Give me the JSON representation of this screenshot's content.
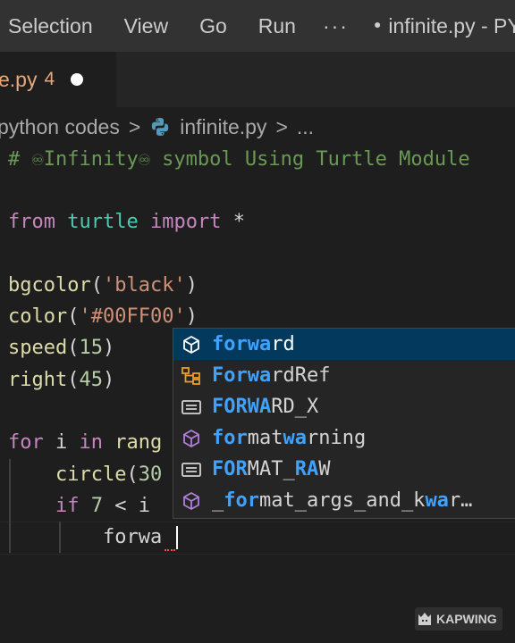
{
  "menubar": {
    "items": [
      {
        "label": "Selection"
      },
      {
        "label": "View"
      },
      {
        "label": "Go"
      },
      {
        "label": "Run"
      },
      {
        "label": "···"
      }
    ],
    "window_title": "infinite.py - PYT",
    "dirty_dot": "●"
  },
  "tab": {
    "name": "e.py",
    "problem_count": "4"
  },
  "breadcrumb": {
    "folder": "python codes",
    "sep1": ">",
    "file": "infinite.py",
    "sep2": ">",
    "more": "..."
  },
  "code": {
    "l1_comment": "# ♾Infinity♾ symbol Using Turtle Module",
    "l2_from": "from",
    "l2_mod": "turtle",
    "l2_import": "import",
    "l2_star": "*",
    "l3_fn": "bgcolor",
    "l3_open": "(",
    "l3_str": "'black'",
    "l3_close": ")",
    "l4_fn": "color",
    "l4_open": "(",
    "l4_str": "'#00FF00'",
    "l4_close": ")",
    "l5_fn": "speed",
    "l5_open": "(",
    "l5_num": "15",
    "l5_close": ")",
    "l6_fn": "right",
    "l6_open": "(",
    "l6_num": "45",
    "l6_close": ")",
    "l7_for": "for",
    "l7_var": "i",
    "l7_in": "in",
    "l7_fn": "rang",
    "l8_fn": "circle",
    "l8_open": "(",
    "l8_num": "30",
    "l9_if": "if",
    "l9_num": "7",
    "l9_lt": "<",
    "l9_var": "i",
    "l10_typed": "forwa"
  },
  "suggest": {
    "items": [
      {
        "icon": "method-cube-icon",
        "match": "forwa",
        "rest": "rd"
      },
      {
        "icon": "class-icon",
        "pre": "",
        "m1": "Forwa",
        "rest": "rdRef"
      },
      {
        "icon": "variable-icon",
        "m1": "FORWA",
        "rest": "RD_X"
      },
      {
        "icon": "method-cube-icon",
        "m1": "for",
        "mid": "mat",
        "m2": "wa",
        "rest": "rning"
      },
      {
        "icon": "variable-icon",
        "m1": "FOR",
        "mid": "MAT_",
        "m2": "RA",
        "rest": "W"
      },
      {
        "icon": "method-cube-icon",
        "pre": "_",
        "m1": "for",
        "mid": "mat_args_and_k",
        "m2": "wa",
        "rest": "r…"
      }
    ]
  },
  "watermark": {
    "label": "KAPWING"
  },
  "colors": {
    "menubar_bg": "#323233",
    "editor_bg": "#1e1e1e",
    "suggest_selected_bg": "#04395e",
    "match_highlight": "#3fa2ff",
    "keyword": "#c586c0",
    "function": "#dcdcaa",
    "string": "#ce9178",
    "number": "#b5cea8",
    "comment": "#6a9955",
    "modified_tab_text": "#e8a87c"
  }
}
